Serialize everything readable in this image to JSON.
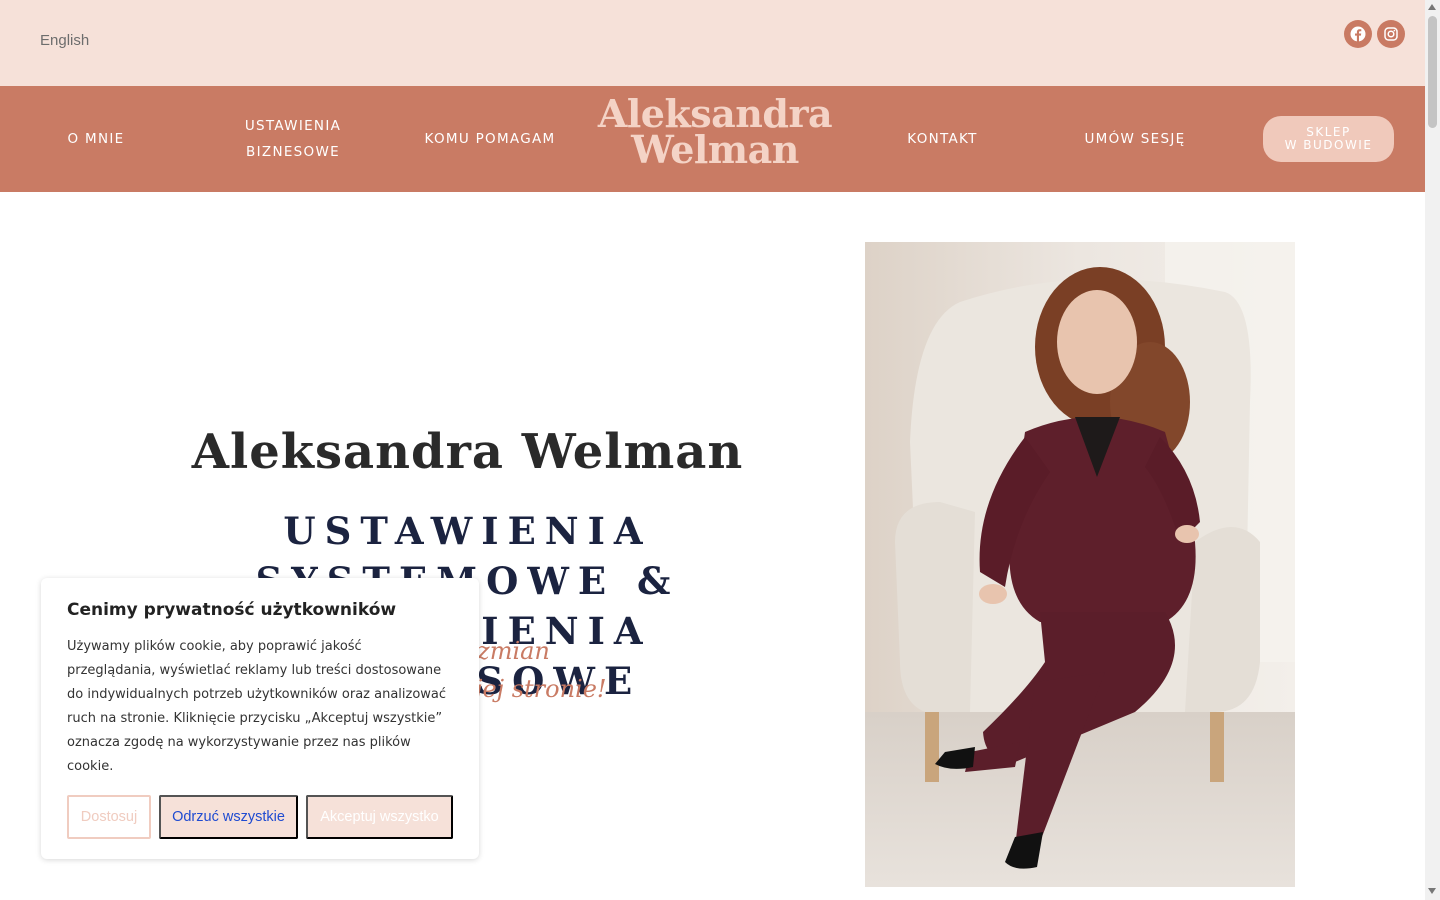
{
  "topbar": {
    "language": "English",
    "social": [
      {
        "icon": "facebook-icon"
      },
      {
        "icon": "instagram-icon"
      }
    ]
  },
  "nav": {
    "o_mnie": "O MNIE",
    "ustawienia_line1": "USTAWIENIA",
    "ustawienia_line2": "BIZNESOWE",
    "komu_pomagam": "KOMU POMAGAM",
    "logo_line1": "Aleksandra",
    "logo_line2": "Welman",
    "kontakt": "KONTAKT",
    "umow_sesje": "UMÓW SESJĘ",
    "shop_line1": "SKLEP",
    "shop_line2": "W BUDOWIE"
  },
  "hero": {
    "name": "Aleksandra Welman",
    "subtitle_line1": "USTAWIENIA SYSTEMOWE &",
    "subtitle_line2": "USTAWIENIA BIZNESOWE",
    "tagline_line1": "siłę do zmian",
    "tagline_line2": "jej stronie!"
  },
  "cookie": {
    "title": "Cenimy prywatność użytkowników",
    "body": "Używamy plików cookie, aby poprawić jakość przeglądania, wyświetlać reklamy lub treści dostosowane do indywidualnych potrzeb użytkowników oraz analizować ruch na stronie. Kliknięcie przycisku „Akceptuj wszystkie” oznacza zgodę na wykorzystywanie przez nas plików cookie.",
    "customize": "Dostosuj",
    "reject": "Odrzuć wszystkie",
    "accept": "Akceptuj wszystko"
  },
  "colors": {
    "topbar_bg": "#f6e1d9",
    "nav_bg": "#c97b64",
    "logo": "#f4d3c6",
    "accent": "#c97b64",
    "heading_dark": "#1b2340"
  }
}
